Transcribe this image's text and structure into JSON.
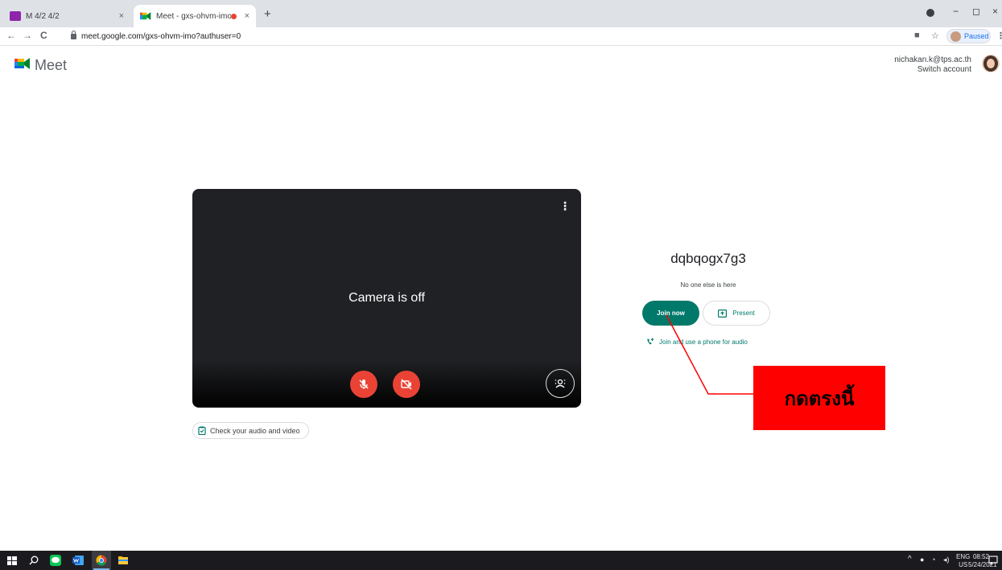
{
  "browser": {
    "tabs": [
      {
        "title": "M 4/2 4/2",
        "close": "×"
      },
      {
        "title": "Meet - gxs-ohvm-imo",
        "close": "×",
        "active": true
      }
    ],
    "new_tab": "+",
    "window_controls": [
      "−",
      "◻",
      "×"
    ],
    "url": "meet.google.com/gxs-ohvm-imo?authuser=0",
    "nav": {
      "back": "←",
      "forward": "→",
      "reload": "C"
    },
    "toolbar_icons": {
      "camera": "■",
      "star": "☆",
      "menu": "⋮"
    },
    "profile_status": "Paused"
  },
  "meet": {
    "logo_text": "Meet",
    "account": {
      "email": "nichakan.k@tps.ac.th",
      "switch_label": "Switch account"
    },
    "preview": {
      "status": "Camera is off",
      "more_icon": "⋮"
    },
    "check_audio_video": "Check your audio and video",
    "meeting_code": "dqbqogx7g3",
    "participants_status": "No one else is here",
    "join_label": "Join now",
    "present_label": "Present",
    "phone_audio_label": "Join and use a phone for audio"
  },
  "annotation": {
    "callout_text": "กดตรงนี้",
    "color": "#ff0000"
  },
  "taskbar": {
    "tray": {
      "language": "ENG",
      "region": "US",
      "time": "08:52",
      "date": "5/24/2021"
    }
  },
  "colors": {
    "accent": "#00796b",
    "danger": "#ea4335",
    "preview_bg": "#202124"
  }
}
